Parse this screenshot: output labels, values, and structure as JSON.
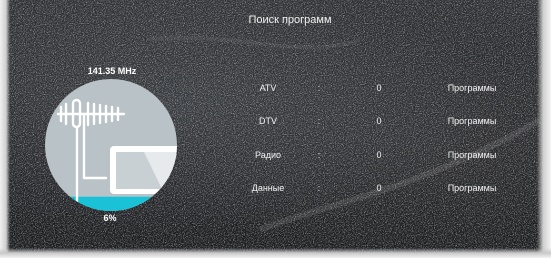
{
  "title": "Поиск программ",
  "frequency": "141.35 MHz",
  "progress": {
    "percent_label": "6%",
    "value": 0.06
  },
  "rows": [
    {
      "label": "ATV",
      "separator": ":",
      "count": "0",
      "unit": "Программы"
    },
    {
      "label": "DTV",
      "separator": ":",
      "count": "0",
      "unit": "Программы"
    },
    {
      "label": "Радио",
      "separator": ":",
      "count": "0",
      "unit": "Программы"
    },
    {
      "label": "Данные",
      "separator": ":",
      "count": "0",
      "unit": "Программы"
    }
  ],
  "colors": {
    "gauge_fill": "#b9c2c6",
    "progress_fill": "#19c2d6",
    "icon": "#ffffff",
    "text": "#f2f2f2"
  },
  "icons": [
    "antenna-icon",
    "tv-screen-icon"
  ]
}
